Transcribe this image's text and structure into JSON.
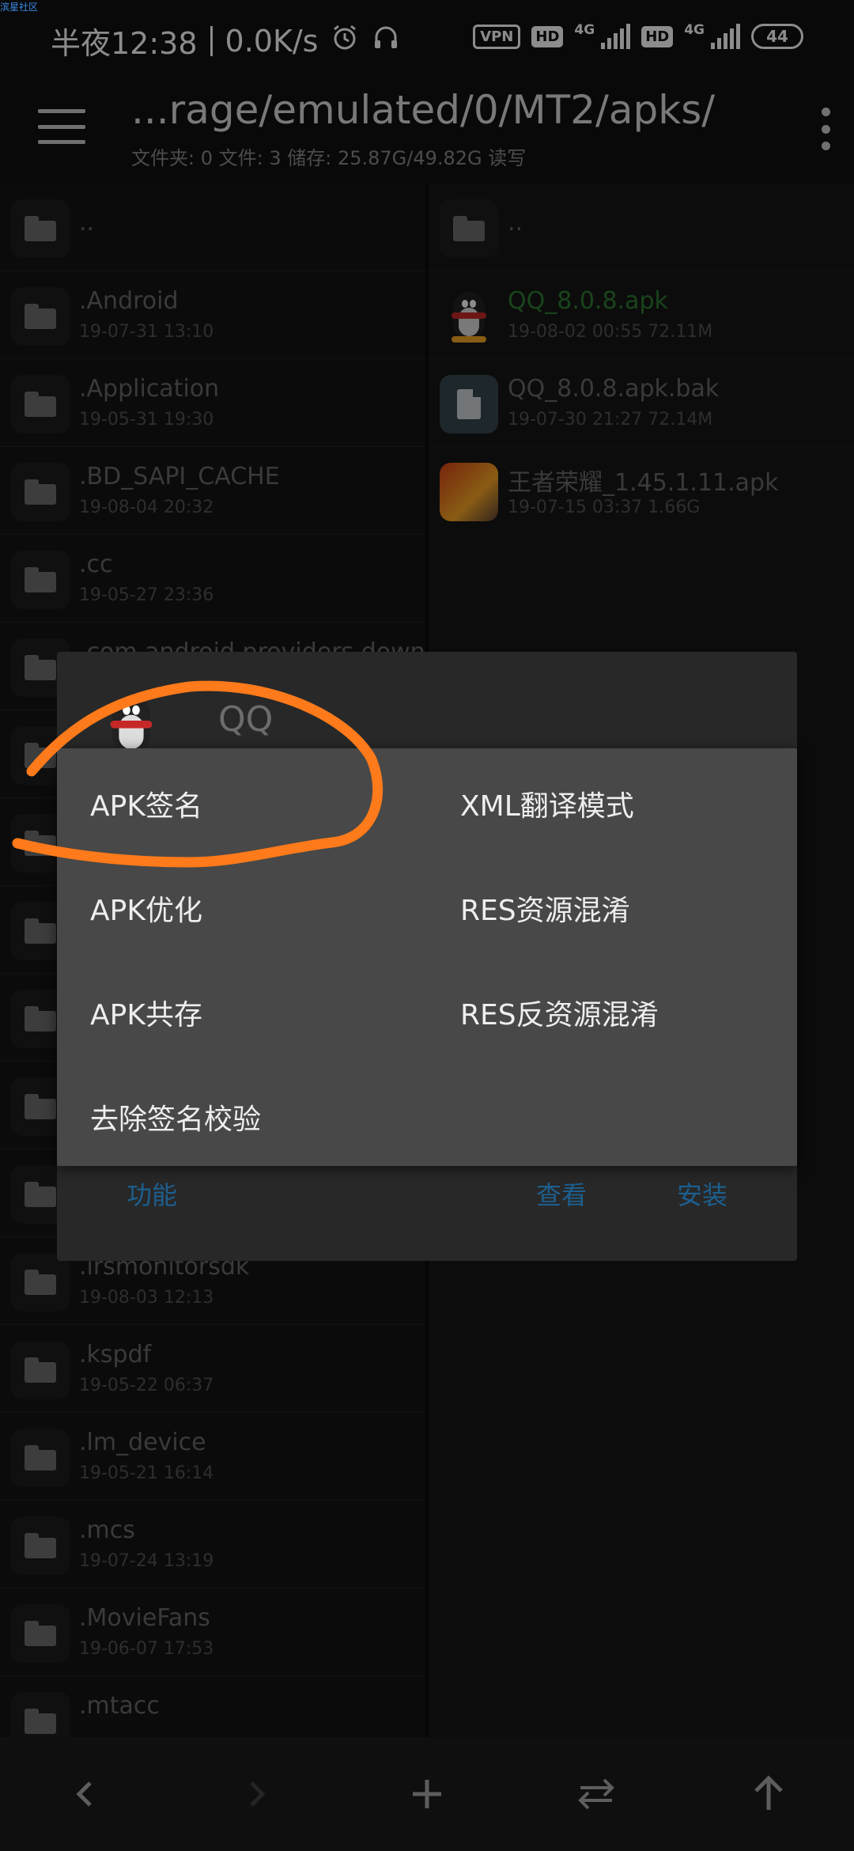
{
  "watermark": "滨星社区",
  "status": {
    "time": "半夜12:38",
    "speed": "0.0K/s",
    "vpn": "VPN",
    "hd": "HD",
    "net": "4G",
    "battery": "44"
  },
  "toolbar": {
    "path": "...rage/emulated/0/MT2/apks/",
    "info": "文件夹: 0  文件: 3  储存: 25.87G/49.82G  读写"
  },
  "left_pane": {
    "up_label": "..",
    "items": [
      {
        "name": ".Android",
        "meta": "19-07-31 13:10"
      },
      {
        "name": ".Application",
        "meta": "19-05-31 19:30"
      },
      {
        "name": ".BD_SAPI_CACHE",
        "meta": "19-08-04 20:32"
      },
      {
        "name": ".cc",
        "meta": "19-05-27 23:36"
      },
      {
        "name": ".com.android.providers.downlo",
        "meta": ""
      },
      {
        "name": "",
        "meta": ""
      },
      {
        "name": "",
        "meta": ""
      },
      {
        "name": "",
        "meta": ""
      },
      {
        "name": "",
        "meta": ""
      },
      {
        "name": "",
        "meta": ""
      },
      {
        "name": "",
        "meta": ""
      },
      {
        "name": ".irsmonitorsdk",
        "meta": "19-08-03 12:13"
      },
      {
        "name": ".kspdf",
        "meta": "19-05-22 06:37"
      },
      {
        "name": ".lm_device",
        "meta": "19-05-21 16:14"
      },
      {
        "name": ".mcs",
        "meta": "19-07-24 13:19"
      },
      {
        "name": ".MovieFans",
        "meta": "19-06-07 17:53"
      },
      {
        "name": ".mtacc",
        "meta": ""
      }
    ]
  },
  "right_pane": {
    "up_label": "..",
    "files": [
      {
        "name": "QQ_8.0.8.apk",
        "meta": "19-08-02 00:55  72.11M"
      },
      {
        "name": "QQ_8.0.8.apk.bak",
        "meta": "19-07-30 21:27  72.14M"
      },
      {
        "name": "王者荣耀_1.45.1.11.apk",
        "meta": "19-07-15 03:37  1.66G"
      }
    ]
  },
  "dialog": {
    "title": "QQ",
    "btn_function": "功能",
    "btn_view": "查看",
    "btn_install": "安装"
  },
  "popup": {
    "apk_sign": "APK签名",
    "xml_translate": "XML翻译模式",
    "apk_optimize": "APK优化",
    "res_obfuscate": "RES资源混淆",
    "apk_coexist": "APK共存",
    "res_deobfuscate": "RES反资源混淆",
    "remove_sign_check": "去除签名校验"
  },
  "colors": {
    "accent_green": "#2e7d32",
    "dialog_button": "#1d5f8f",
    "scribble": "#ff7a1a"
  }
}
